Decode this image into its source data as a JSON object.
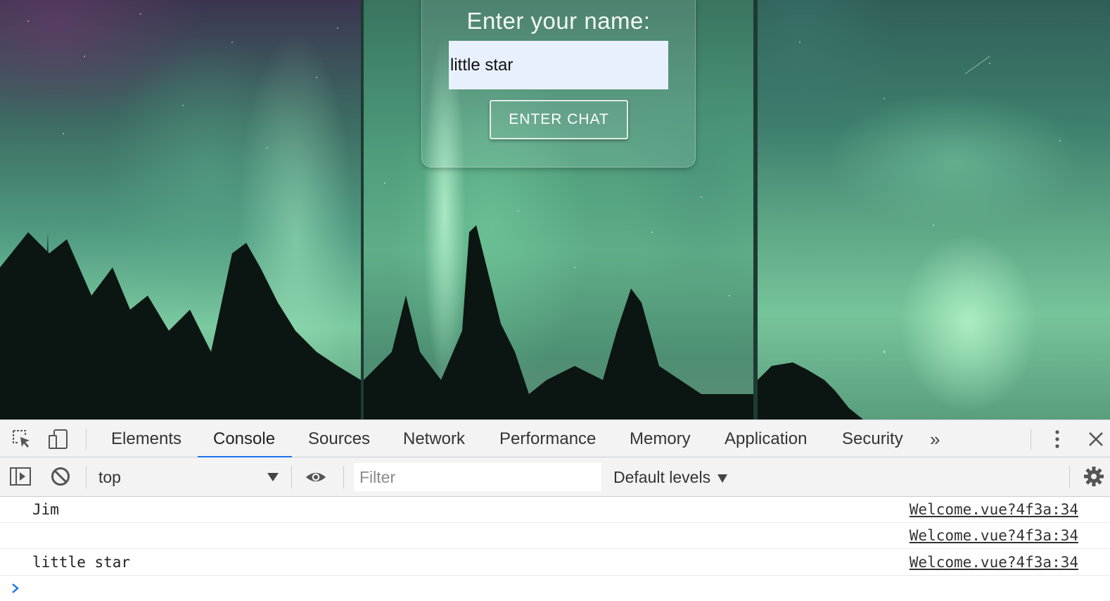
{
  "login": {
    "prompt": "Enter your name:",
    "name_value": "little star",
    "enter_button": "ENTER CHAT"
  },
  "devtools": {
    "tabs": [
      "Elements",
      "Console",
      "Sources",
      "Network",
      "Performance",
      "Memory",
      "Application",
      "Security"
    ],
    "active_tab": "Console",
    "more_tabs_label": "»",
    "context": "top",
    "filter_placeholder": "Filter",
    "levels_label": "Default levels",
    "logs": [
      {
        "message": "Jim",
        "source": "Welcome.vue?4f3a:34"
      },
      {
        "message": "",
        "source": "Welcome.vue?4f3a:34"
      },
      {
        "message": "little star",
        "source": "Welcome.vue?4f3a:34"
      }
    ]
  },
  "colors": {
    "accent": "#1a73e8",
    "input_autofill_bg": "#e8f0fe",
    "devtools_bar_bg": "#f3f3f3"
  },
  "icons": {
    "inspect": "inspect-element-icon",
    "device": "device-toolbar-icon",
    "sidebar": "show-sidebar-icon",
    "clear": "clear-console-icon",
    "eye": "live-expression-icon",
    "settings": "gear-icon",
    "menu": "kebab-menu-icon",
    "close": "close-icon",
    "prompt": "console-prompt-icon"
  }
}
